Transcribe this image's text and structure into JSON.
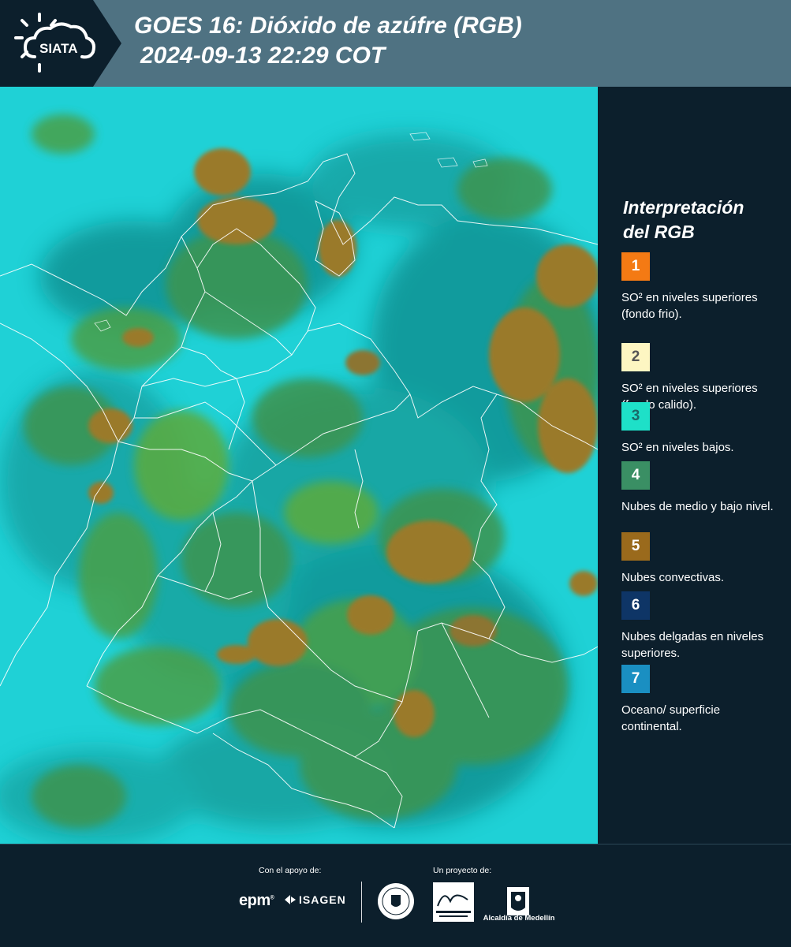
{
  "header": {
    "logo_text": "SIATA",
    "title": "GOES 16: Dióxido de azúfre (RGB)",
    "subtitle": "2024-09-13 22:29 COT"
  },
  "map": {
    "background_color": "#1fd1d6",
    "cloud_colors": [
      "#9a7a2c",
      "#3c9450",
      "#5cab3c",
      "#0f8a8a"
    ],
    "border_color": "#ffffff"
  },
  "legend": {
    "title_line1": "Interpretación",
    "title_line2": "del RGB",
    "items": [
      {
        "number": "1",
        "color": "#f47a14",
        "text_color": "#ffffff",
        "label": "SO² en niveles superiores (fondo frio)."
      },
      {
        "number": "2",
        "color": "#fdf6c2",
        "text_color": "#555555",
        "label": "SO² en niveles superiores (fondo calido)."
      },
      {
        "number": "3",
        "color": "#1ee0c8",
        "text_color": "#1a6a68",
        "label": "SO² en niveles bajos."
      },
      {
        "number": "4",
        "color": "#3a8f64",
        "text_color": "#ffffff",
        "label": "Nubes de medio y bajo nivel."
      },
      {
        "number": "5",
        "color": "#9a6a1c",
        "text_color": "#ffffff",
        "label": "Nubes convectivas."
      },
      {
        "number": "6",
        "color": "#0e3566",
        "text_color": "#ffffff",
        "label": "Nubes delgadas en niveles superiores."
      },
      {
        "number": "7",
        "color": "#1a8fc2",
        "text_color": "#ffffff",
        "label": "Oceano/ superficie continental."
      }
    ]
  },
  "footer": {
    "support_label": "Con el apoyo de:",
    "project_label": "Un proyecto de:",
    "epm": "epm",
    "epm_mark": "®",
    "isagen": "ISAGEN",
    "alcaldia": "Alcaldía de Medellín"
  }
}
